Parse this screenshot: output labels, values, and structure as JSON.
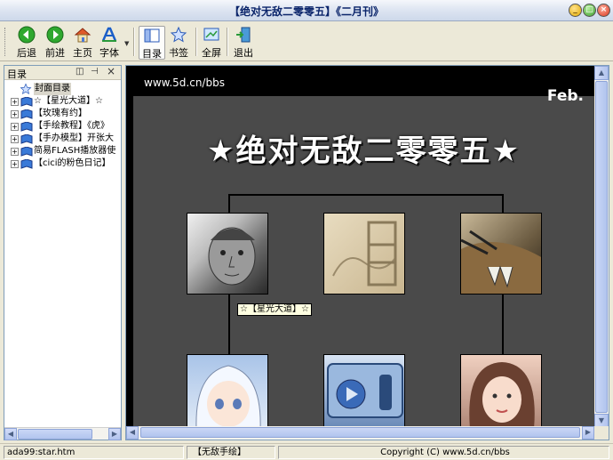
{
  "window": {
    "title": "【绝对无敌二零零五】《二月刊》",
    "min": "_",
    "max": "□",
    "close": "×"
  },
  "toolbar": {
    "back": "后退",
    "forward": "前进",
    "home": "主页",
    "font": "字体",
    "toc": "目录",
    "bookmark": "书签",
    "fullscreen": "全屏",
    "exit": "退出"
  },
  "sidebar": {
    "title": "目录",
    "pin": "⊣",
    "close": "×",
    "items": [
      {
        "label": "封面目录"
      },
      {
        "label": "☆【星光大道】☆"
      },
      {
        "label": "【玫瑰有约】"
      },
      {
        "label": "【手绘教程】《虎》"
      },
      {
        "label": "【手办模型】开张大"
      },
      {
        "label": "简易FLASH播放器使"
      },
      {
        "label": "【cici的粉色日记】"
      }
    ]
  },
  "page": {
    "url": "www.5d.cn/bbs",
    "month": "Feb.",
    "headline": "★绝对无敌二零零五★",
    "tooltip": "☆【星光大道】☆"
  },
  "statusbar": {
    "file": "ada99:star.htm",
    "section": "【无敌手绘】",
    "copyright": "Copyright (C) www.5d.cn/bbs"
  },
  "colors": {
    "accent": "#0a246a",
    "page_bg": "#4a4a4a"
  }
}
